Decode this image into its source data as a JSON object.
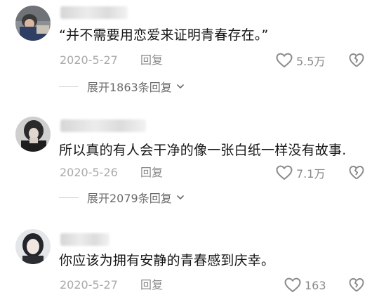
{
  "comments": [
    {
      "text": "“并不需要用恋爱来证明青春存在。”",
      "date": "2020-5-27",
      "reply_label": "回复",
      "likes": "5.5万",
      "expand_label": "展开1863条回复"
    },
    {
      "text": "所以真的有人会干净的像一张白纸一样没有故事.",
      "date": "2020-5-26",
      "reply_label": "回复",
      "likes": "7.1万",
      "expand_label": "展开2079条回复"
    },
    {
      "text": "你应该为拥有安静的青春感到庆幸。",
      "date": "2020-5-27",
      "reply_label": "回复",
      "likes": "163"
    }
  ],
  "colors": {
    "text": "#161616",
    "meta": "#a9a9a9",
    "icon": "#8a8a8a"
  },
  "icons": {
    "like": "heart-outline-icon",
    "dislike": "broken-heart-icon",
    "expand": "chevron-down-icon"
  }
}
